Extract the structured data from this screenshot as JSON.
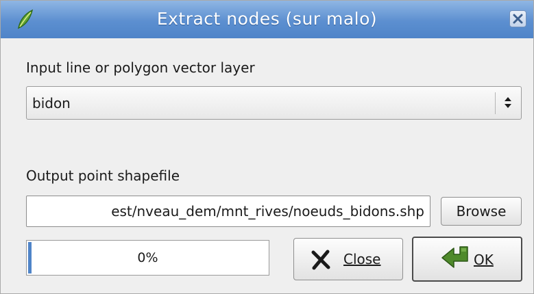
{
  "dialog": {
    "title": "Extract nodes (sur malo)"
  },
  "input_layer": {
    "label": "Input line or polygon vector layer",
    "selected": "bidon"
  },
  "output": {
    "label": "Output point shapefile",
    "path_value": "est/nveau_dem/mnt_rives/noeuds_bidons.shp",
    "browse_label": "Browse"
  },
  "progress": {
    "value": 0,
    "text": "0%"
  },
  "buttons": {
    "close_label": "Close",
    "ok_label": "OK"
  },
  "icons": {
    "title": "qgis-logo-icon",
    "window_close": "close-icon",
    "combo": "up-down-arrows-icon",
    "close_button": "x-icon",
    "ok_button": "check-arrow-icon"
  },
  "colors": {
    "titlebar": "#5c8fd0",
    "progress_fill": "#4f84c8",
    "ok_icon": "#4f8a2b"
  }
}
